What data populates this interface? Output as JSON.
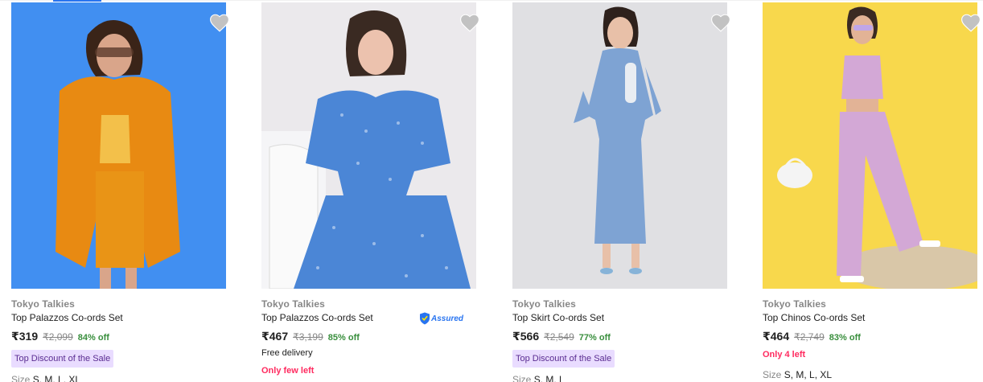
{
  "products": [
    {
      "brand": "Tokyo Talkies",
      "title": "Top Palazzos Co-ords Set",
      "price": "₹319",
      "mrp": "₹2,099",
      "discount": "84% off",
      "badge": "Top Discount of the Sale",
      "sizes_label": "Size",
      "sizes": "S, M, L, XL",
      "wishlist_icon": "heart-icon",
      "bg_color": "#3d8cf0",
      "outfit_color": "#e88a12"
    },
    {
      "brand": "Tokyo Talkies",
      "title": "Top Palazzos Co-ords Set",
      "price": "₹467",
      "mrp": "₹3,199",
      "discount": "85% off",
      "assured_label": "Assured",
      "delivery": "Free delivery",
      "urgency": "Only few left",
      "wishlist_icon": "heart-icon",
      "bg_color": "#ebe9ec",
      "outfit_color": "#4b86d6"
    },
    {
      "brand": "Tokyo Talkies",
      "title": "Top Skirt Co-ords Set",
      "price": "₹566",
      "mrp": "₹2,549",
      "discount": "77% off",
      "badge": "Top Discount of the Sale",
      "sizes_label": "Size",
      "sizes": "S, M, L",
      "wishlist_icon": "heart-icon",
      "bg_color": "#dcdcdf",
      "outfit_color": "#7ea3d3"
    },
    {
      "brand": "Tokyo Talkies",
      "title": "Top Chinos Co-ords Set",
      "price": "₹464",
      "mrp": "₹2,749",
      "discount": "83% off",
      "urgency": "Only 4 left",
      "sizes_label": "Size",
      "sizes": "S, M, L, XL",
      "wishlist_icon": "heart-icon",
      "bg_color": "#f6d23c",
      "outfit_color": "#d3a8d6"
    }
  ],
  "colors": {
    "price_off": "#388e3c",
    "urgency": "#ff2a5f",
    "badge_bg": "#e9dcff",
    "badge_text": "#5a2c91",
    "muted": "#878787",
    "accent": "#2874f0"
  }
}
